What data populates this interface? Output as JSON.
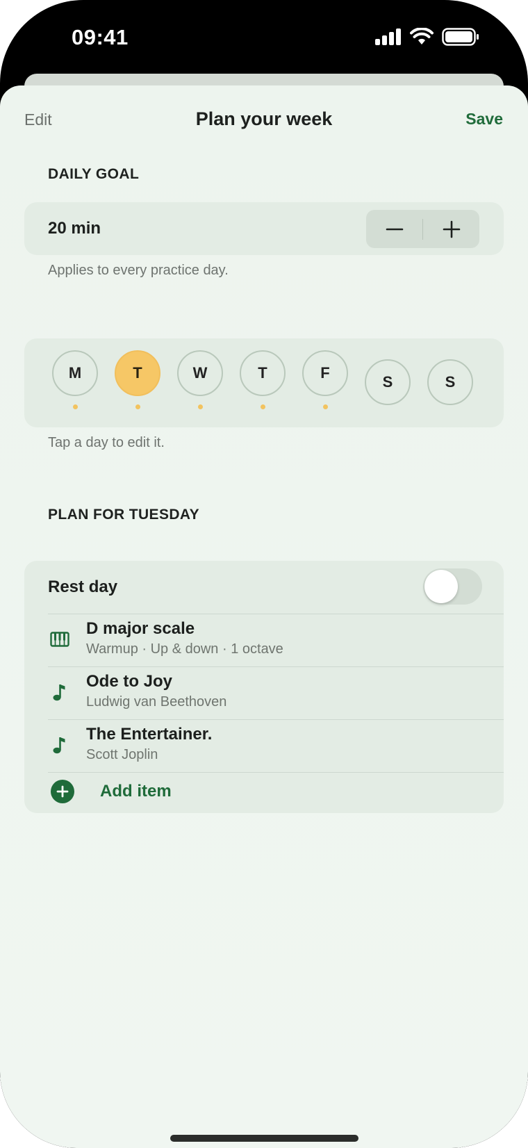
{
  "status_bar": {
    "time": "09:41"
  },
  "nav": {
    "edit_label": "Edit",
    "title": "Plan your week",
    "save_label": "Save"
  },
  "daily_goal": {
    "header": "DAILY GOAL",
    "value": "20 min",
    "decrement_symbol": "−",
    "increment_symbol": "+",
    "footnote": "Applies to every practice day."
  },
  "days": {
    "items": [
      {
        "label": "M",
        "selected": false,
        "has_plan": true
      },
      {
        "label": "T",
        "selected": true,
        "has_plan": true
      },
      {
        "label": "W",
        "selected": false,
        "has_plan": true
      },
      {
        "label": "T",
        "selected": false,
        "has_plan": true
      },
      {
        "label": "F",
        "selected": false,
        "has_plan": true
      },
      {
        "label": "S",
        "selected": false,
        "has_plan": false
      },
      {
        "label": "S",
        "selected": false,
        "has_plan": false
      }
    ],
    "footnote": "Tap a day to edit it."
  },
  "plan": {
    "header": "PLAN FOR TUESDAY",
    "rest_day_label": "Rest day",
    "rest_day_on": false,
    "items": [
      {
        "icon": "piano-keys-icon",
        "title": "D major scale",
        "subtitle": "Warmup · Up & down · 1 octave"
      },
      {
        "icon": "music-note-icon",
        "title": "Ode to Joy",
        "subtitle": "Ludwig van Beethoven"
      },
      {
        "icon": "music-note-icon",
        "title": "The Entertainer.",
        "subtitle": "Scott Joplin"
      }
    ],
    "add_label": "Add item"
  },
  "colors": {
    "accent": "#1f6b3a",
    "day_selected": "#f6c766",
    "dot": "#f2c35f"
  }
}
